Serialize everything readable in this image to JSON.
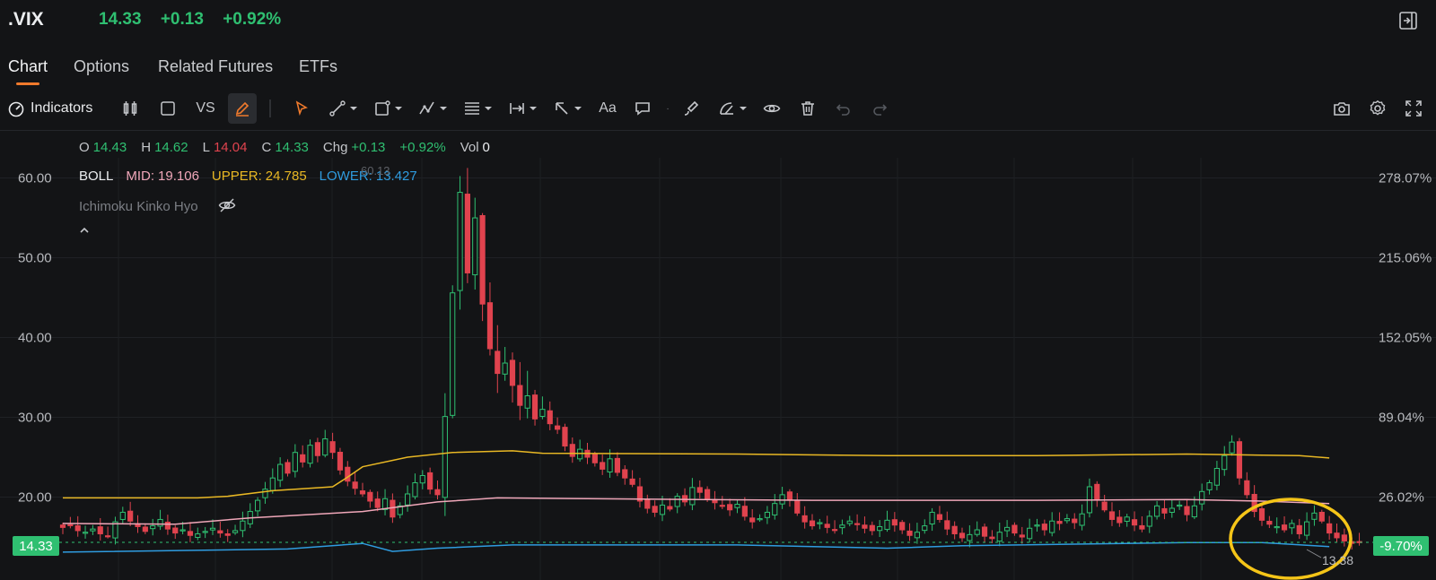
{
  "header": {
    "symbol": ".VIX",
    "last": "14.33",
    "change": "+0.13",
    "change_pct": "+0.92%"
  },
  "tabs": [
    {
      "label": "Chart",
      "active": true
    },
    {
      "label": "Options",
      "active": false
    },
    {
      "label": "Related Futures",
      "active": false
    },
    {
      "label": "ETFs",
      "active": false
    }
  ],
  "toolbar": {
    "indicators_label": "Indicators",
    "vs_label": "VS",
    "text_tool_label": "Aa",
    "icons": [
      "indicators-icon",
      "candlestick-type-icon",
      "square-icon",
      "vs",
      "pencil-icon",
      "cursor-arrow-icon",
      "trend-line-icon",
      "shape-icon",
      "pattern-icon",
      "fib-icon",
      "measure-icon",
      "arrow-icon",
      "text-icon",
      "comment-icon",
      "brush-icon",
      "emotion-icon",
      "eye-icon",
      "trash-icon",
      "undo-icon",
      "redo-icon",
      "camera-icon",
      "settings-gear-icon",
      "fullscreen-icon"
    ]
  },
  "legend": {
    "open_label": "O",
    "open": "14.43",
    "high_label": "H",
    "high": "14.62",
    "low_label": "L",
    "low": "14.04",
    "close_label": "C",
    "close": "14.33",
    "chg_label": "Chg",
    "chg": "+0.13",
    "chg_pct": "+0.92%",
    "vol_label": "Vol",
    "vol": "0",
    "boll_label": "BOLL",
    "mid_label": "MID:",
    "mid": "19.106",
    "upper_label": "UPPER:",
    "upper": "24.785",
    "lower_label": "LOWER:",
    "lower": "13.427",
    "ichimoku_label": "Ichimoku Kinko Hyo"
  },
  "tags": {
    "price": "14.33",
    "pct": "-9.70%",
    "low_annotation": "13.38",
    "high_annotation": "60.13"
  },
  "colors": {
    "up": "#2fbf71",
    "down": "#e0434e",
    "upper_band": "#e9b824",
    "mid_band": "#f0a7b9",
    "lower_band": "#2f9ce0",
    "accent": "#f07a2c",
    "highlight_circle": "#f5c518"
  },
  "chart_data": {
    "type": "candlestick",
    "y_ticks_left": [
      "60.00",
      "50.00",
      "40.00",
      "30.00",
      "20.00"
    ],
    "y_ticks_right": [
      "278.07%",
      "215.06%",
      "152.05%",
      "89.04%",
      "26.02%"
    ],
    "ylim": [
      11.3,
      62.8
    ],
    "candle_count": 170,
    "last_close": 14.33,
    "bands": {
      "upper": [
        [
          0,
          19.9
        ],
        [
          18,
          19.9
        ],
        [
          22,
          20.1
        ],
        [
          28,
          20.8
        ],
        [
          36,
          21.3
        ],
        [
          38,
          22.5
        ],
        [
          40,
          23.8
        ],
        [
          46,
          25.0
        ],
        [
          52,
          25.6
        ],
        [
          60,
          25.8
        ],
        [
          64,
          25.5
        ],
        [
          90,
          25.4
        ],
        [
          110,
          25.2
        ],
        [
          130,
          25.2
        ],
        [
          150,
          25.4
        ],
        [
          165,
          25.2
        ],
        [
          169,
          24.9
        ]
      ],
      "mid": [
        [
          0,
          16.7
        ],
        [
          15,
          16.6
        ],
        [
          25,
          17.4
        ],
        [
          40,
          18.2
        ],
        [
          50,
          19.4
        ],
        [
          58,
          19.9
        ],
        [
          70,
          19.8
        ],
        [
          100,
          19.6
        ],
        [
          130,
          19.6
        ],
        [
          150,
          19.7
        ],
        [
          160,
          19.5
        ],
        [
          169,
          19.2
        ]
      ],
      "lower": [
        [
          0,
          13.1
        ],
        [
          30,
          13.5
        ],
        [
          40,
          14.2
        ],
        [
          44,
          13.2
        ],
        [
          50,
          13.6
        ],
        [
          60,
          14.0
        ],
        [
          90,
          14.0
        ],
        [
          110,
          13.6
        ],
        [
          120,
          13.9
        ],
        [
          150,
          14.3
        ],
        [
          160,
          14.3
        ],
        [
          169,
          13.8
        ]
      ]
    },
    "closes": [
      16.2,
      16.5,
      15.8,
      15.6,
      16.0,
      15.4,
      15.1,
      16.9,
      18.1,
      17.0,
      16.3,
      15.7,
      16.4,
      17.2,
      16.0,
      15.5,
      15.9,
      15.2,
      15.4,
      15.7,
      16.1,
      15.5,
      15.2,
      15.8,
      17.0,
      18.2,
      19.6,
      21.0,
      22.4,
      24.1,
      23.0,
      25.6,
      24.4,
      26.5,
      25.2,
      27.3,
      25.6,
      23.4,
      22.0,
      21.1,
      20.4,
      19.5,
      18.7,
      19.8,
      17.5,
      18.9,
      20.4,
      21.8,
      22.7,
      21.0,
      20.3,
      30.1,
      45.6,
      58.2,
      48.1,
      55.0,
      44.2,
      38.6,
      35.5,
      36.8,
      34.0,
      31.5,
      32.7,
      29.8,
      31.0,
      29.2,
      28.5,
      26.4,
      25.1,
      26.0,
      25.0,
      24.3,
      23.5,
      24.8,
      23.1,
      22.4,
      21.6,
      19.5,
      18.6,
      18.1,
      19.0,
      18.5,
      20.1,
      19.4,
      21.2,
      20.6,
      19.8,
      19.3,
      18.9,
      18.4,
      19.1,
      17.6,
      16.9,
      17.3,
      18.1,
      19.2,
      20.3,
      19.6,
      18.0,
      16.9,
      16.4,
      16.8,
      16.2,
      15.9,
      16.5,
      17.0,
      16.6,
      16.1,
      15.8,
      16.3,
      17.1,
      16.5,
      15.9,
      15.2,
      15.6,
      16.4,
      18.1,
      17.2,
      16.0,
      15.4,
      14.9,
      15.3,
      15.9,
      15.1,
      14.8,
      15.6,
      16.2,
      15.5,
      15.0,
      16.1,
      16.5,
      15.9,
      17.0,
      16.7,
      17.3,
      16.8,
      17.9,
      21.3,
      19.6,
      18.4,
      17.2,
      16.8,
      17.5,
      16.5,
      16.0,
      17.6,
      18.9,
      18.0,
      18.6,
      19.0,
      17.8,
      18.9,
      20.7,
      21.8,
      23.6,
      25.2,
      26.9,
      22.4,
      20.3,
      18.2,
      17.1,
      16.6,
      16.3,
      15.9,
      16.7,
      15.4,
      16.9,
      18.0,
      17.0,
      15.5,
      14.9,
      14.5,
      14.2,
      14.33
    ]
  }
}
